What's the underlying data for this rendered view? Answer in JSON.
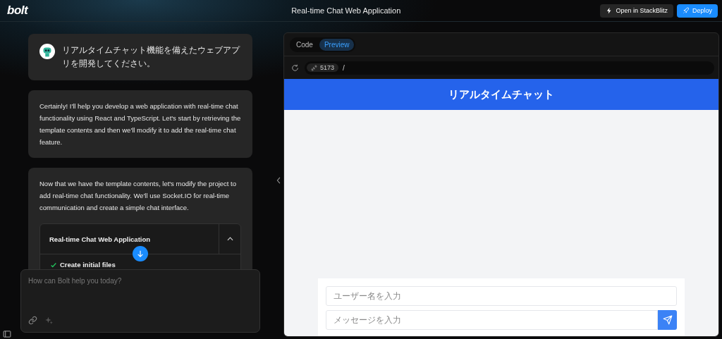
{
  "header": {
    "logo": "bolt",
    "title": "Real-time Chat Web Application",
    "buttons": [
      {
        "kind": "secondary",
        "label": "Open in StackBlitz"
      },
      {
        "kind": "primary",
        "label": "Deploy"
      }
    ]
  },
  "messages": [
    {
      "kind": "user",
      "text": "リアルタイムチャット機能を備えたウェブアプリを開発してください。"
    },
    {
      "kind": "assistant",
      "text": "Certainly! I'll help you develop a web application with real-time chat functionality using React and TypeScript. Let's start by retrieving the template contents and then we'll modify it to add the real-time chat feature."
    },
    {
      "kind": "assistant",
      "text": "Now that we have the template contents, let's modify the project to add real-time chat functionality. We'll use Socket.IO for real-time communication and create a simple chat interface.",
      "artifact": {
        "title": "Real-time Chat Web Application",
        "expanded": true,
        "steps": [
          {
            "label": "Create initial files",
            "done": true
          }
        ]
      }
    }
  ],
  "prompt": {
    "placeholder": "How can Bolt help you today?"
  },
  "workbench": {
    "tabs": [
      {
        "label": "Code",
        "selected": false
      },
      {
        "label": "Preview",
        "selected": true
      }
    ],
    "port": "5173",
    "path": "/",
    "app": {
      "title": "リアルタイムチャット",
      "username_placeholder": "ユーザー名を入力",
      "message_placeholder": "メッセージを入力"
    }
  }
}
